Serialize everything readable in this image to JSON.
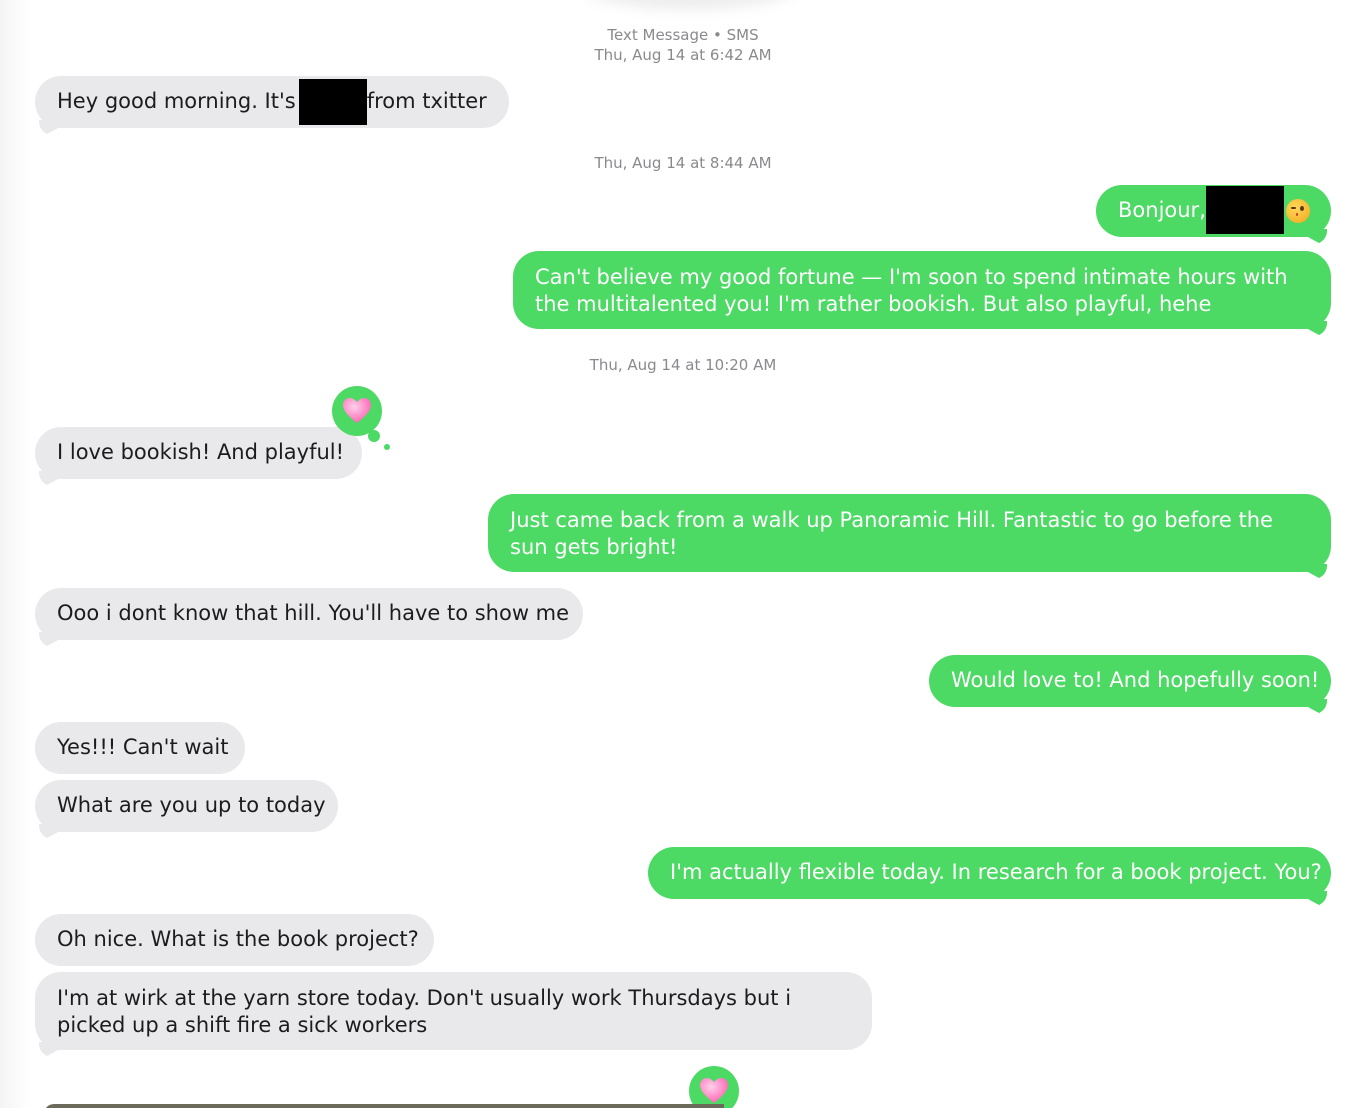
{
  "thread": {
    "stamp_sms": "Text Message • SMS",
    "stamp_1": "Thu, Aug 14 at 6:42 AM",
    "stamp_2": "Thu, Aug 14 at 8:44 AM",
    "stamp_3": "Thu, Aug 14 at 10:20 AM"
  },
  "messages": {
    "m1_pre": "Hey good morning.   It's",
    "m1_post": "from txitter",
    "m2_pre": "Bonjour,",
    "m3": "Can't believe my good fortune — I'm soon to spend intimate hours with the multitalented you! I'm rather bookish. But also playful, hehe",
    "m4": "I love bookish!  And playful!",
    "m5": "Just came back from a walk up Panoramic Hill. Fantastic to go before the sun gets bright!",
    "m6": "Ooo i dont know that hill.  You'll have to show me",
    "m7": "Would love to! And hopefully soon!",
    "m8": "Yes!!! Can't wait",
    "m9": "What are you up to today",
    "m10": "I'm actually flexible today. In research for a book project. You?",
    "m11": "Oh nice. What is the book project?",
    "m12": "I'm at wirk at the yarn store today. Don't usually work Thursdays but i picked up a shift fire a sick workers"
  },
  "tapbacks": {
    "icon": "heart-icon",
    "color": "#4cd964"
  },
  "colors": {
    "outgoing": "#4cd964",
    "incoming": "#e9e9eb",
    "timestamp": "#8a8a8e"
  }
}
